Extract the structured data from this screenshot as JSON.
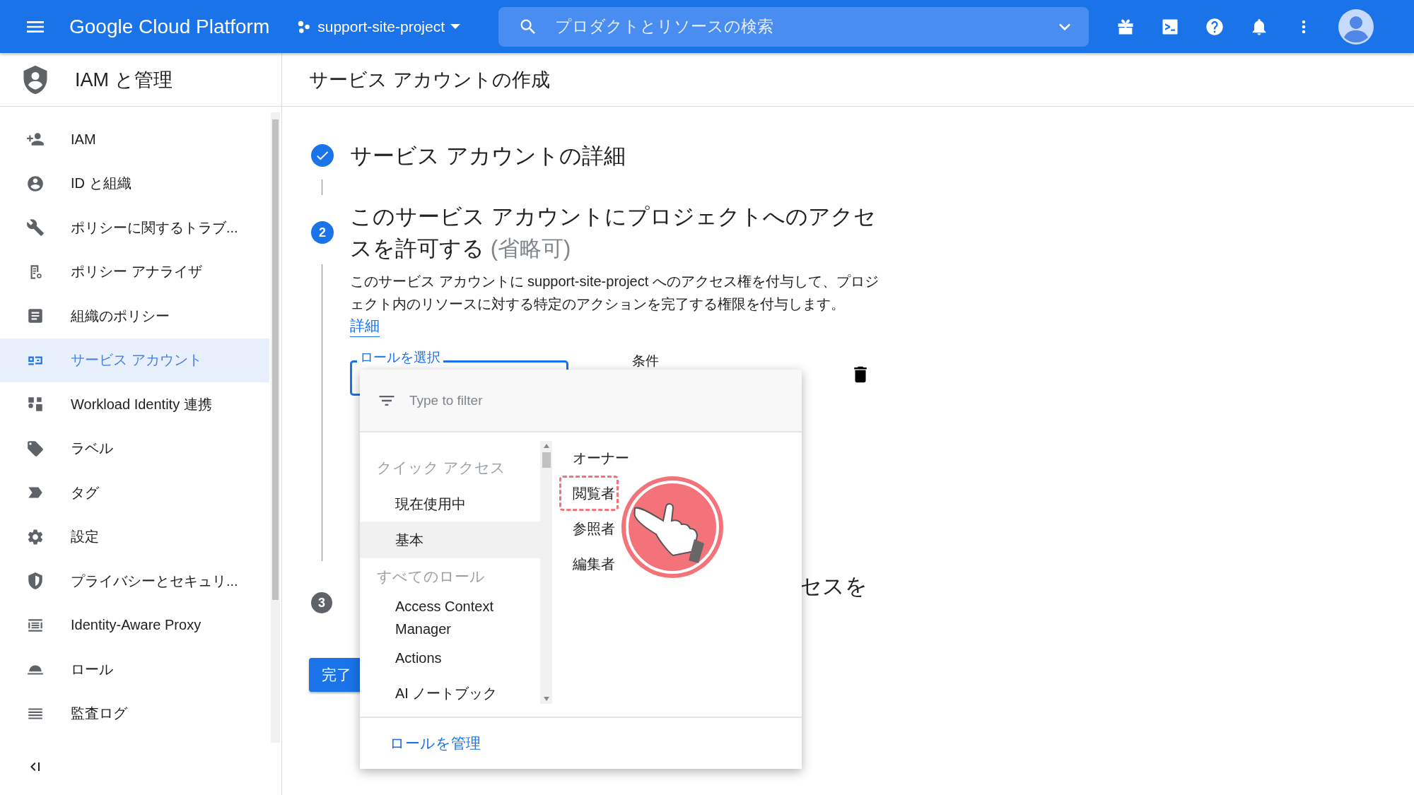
{
  "topbar": {
    "product": "Google Cloud Platform",
    "project": "support-site-project",
    "search": {
      "placeholder": "プロダクトとリソースの検索"
    }
  },
  "sidebar": {
    "title": "IAM と管理",
    "items": [
      {
        "label": "IAM",
        "selected": false
      },
      {
        "label": "ID と組織",
        "selected": false
      },
      {
        "label": "ポリシーに関するトラブ...",
        "selected": false
      },
      {
        "label": "ポリシー アナライザ",
        "selected": false
      },
      {
        "label": "組織のポリシー",
        "selected": false
      },
      {
        "label": "サービス アカウント",
        "selected": true
      },
      {
        "label": "Workload Identity 連携",
        "selected": false
      },
      {
        "label": "ラベル",
        "selected": false
      },
      {
        "label": "タグ",
        "selected": false
      },
      {
        "label": "設定",
        "selected": false
      },
      {
        "label": "プライバシーとセキュリ...",
        "selected": false
      },
      {
        "label": "Identity-Aware Proxy",
        "selected": false
      },
      {
        "label": "ロール",
        "selected": false
      },
      {
        "label": "監査ログ",
        "selected": false
      }
    ]
  },
  "page_title": "サービス アカウントの作成",
  "step_1": {
    "completed": true,
    "title": "サービス アカウントの詳細"
  },
  "step_2": {
    "active": true,
    "number": "2",
    "title": "このサービス アカウントにプロジェクトへのアクセスを許可する",
    "optional": "(省略可)",
    "description": "このサービス アカウントに support-site-project へのアクセス権を付与して、プロジェクト内のリソースに対する特定のアクションを完了する権限を付与します。",
    "link": "詳細",
    "role_field": {
      "label": "ロールを選択"
    },
    "condition_label": "条件"
  },
  "step_3": {
    "active": false,
    "number": "3",
    "title": "セスを"
  },
  "done_button": "完了",
  "dropdown": {
    "filter": {
      "placeholder": "Type to filter"
    },
    "categories": [
      {
        "kind": "heading",
        "label": "クイック アクセス"
      },
      {
        "kind": "item",
        "label": "現在使用中",
        "selected": false
      },
      {
        "kind": "item",
        "label": "基本",
        "selected": true
      },
      {
        "kind": "heading",
        "label": "すべてのロール"
      },
      {
        "kind": "item",
        "label": "Access Context Manager",
        "selected": false
      },
      {
        "kind": "item",
        "label": "Actions",
        "selected": false
      },
      {
        "kind": "item",
        "label": "AI ノートブック",
        "selected": false
      }
    ],
    "roles": [
      {
        "label": "オーナー",
        "highlighted": false
      },
      {
        "label": "閲覧者",
        "highlighted": true
      },
      {
        "label": "参照者",
        "highlighted": false
      },
      {
        "label": "編集者",
        "highlighted": false
      }
    ],
    "footer_link": "ロールを管理"
  }
}
